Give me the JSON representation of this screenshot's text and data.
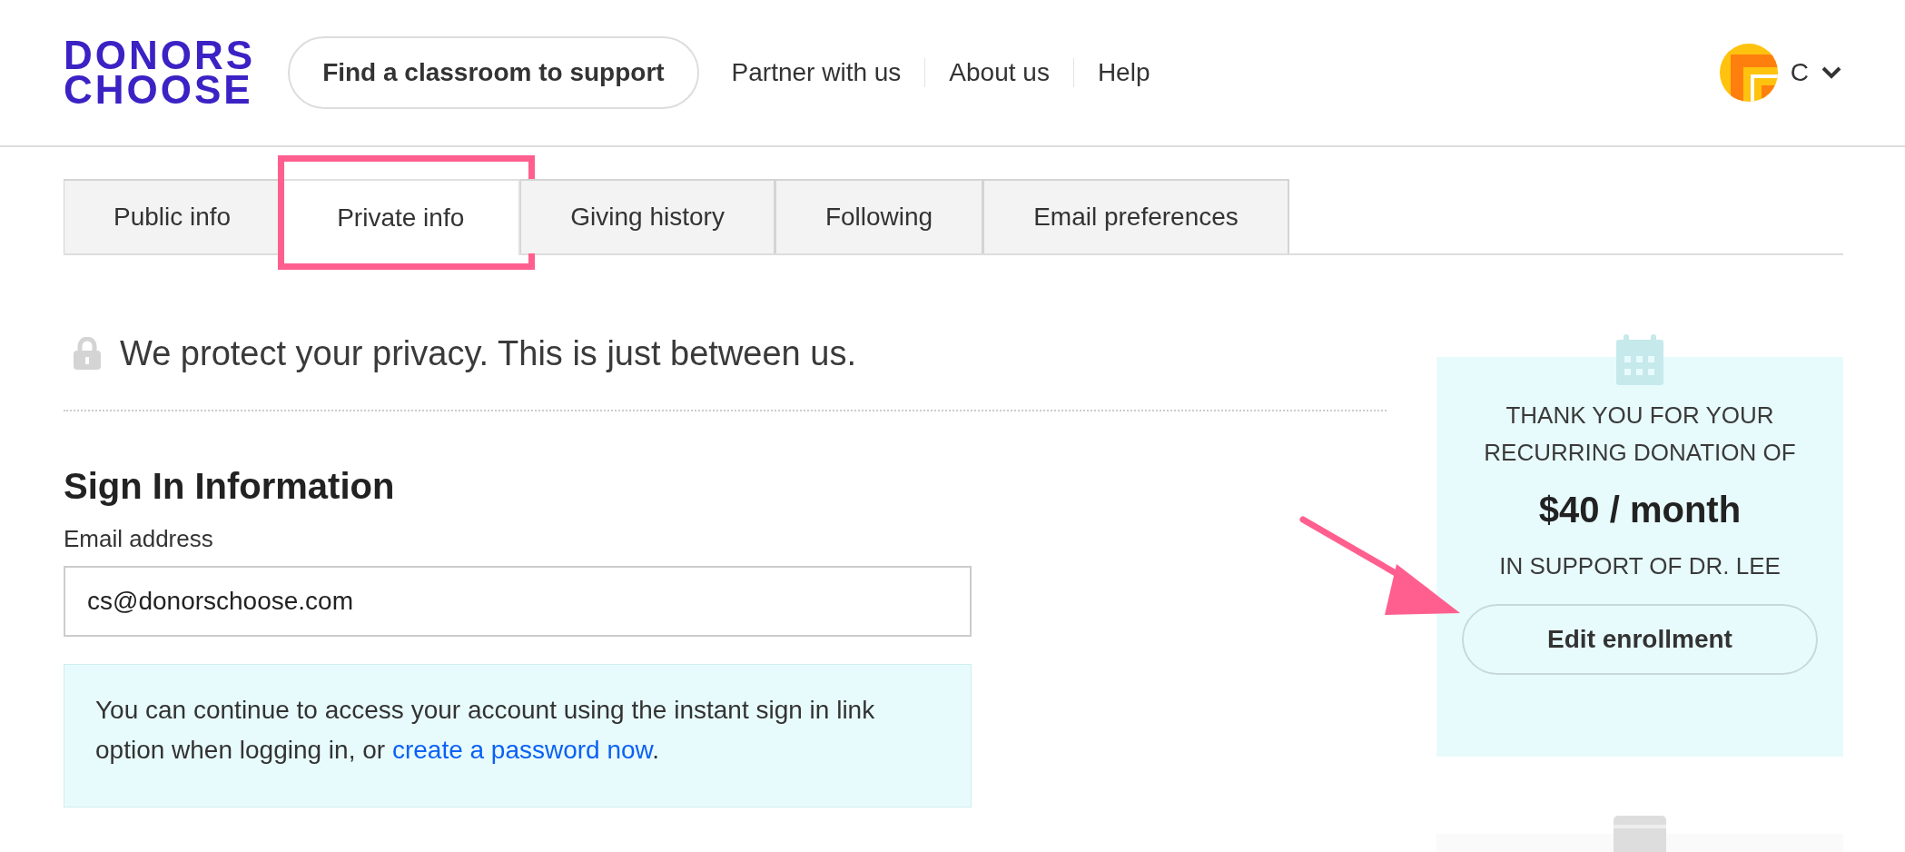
{
  "logo": {
    "lines": [
      "DONORS",
      "CHOOSE"
    ]
  },
  "nav": {
    "primary_button": "Find a classroom to support",
    "links": [
      "Partner with us",
      "About us",
      "Help"
    ]
  },
  "account": {
    "initial": "C"
  },
  "tabs": [
    {
      "label": "Public info",
      "selected": false
    },
    {
      "label": "Private info",
      "selected": true
    },
    {
      "label": "Giving history",
      "selected": false
    },
    {
      "label": "Following",
      "selected": false
    },
    {
      "label": "Email preferences",
      "selected": false
    }
  ],
  "privacy_note": "We protect your privacy. This is just between us.",
  "sign_in": {
    "heading": "Sign In Information",
    "email_label": "Email address",
    "email_value": "cs@donorschoose.com",
    "notice": {
      "text": "You can continue to access your account using the instant sign in link option when logging in, or ",
      "link": "create a password now",
      "after": "."
    }
  },
  "donation_card": {
    "intro": "THANK YOU FOR YOUR RECURRING DONATION OF",
    "amount": "$40 / month",
    "support": "IN SUPPORT OF DR. LEE",
    "button": "Edit enrollment"
  }
}
